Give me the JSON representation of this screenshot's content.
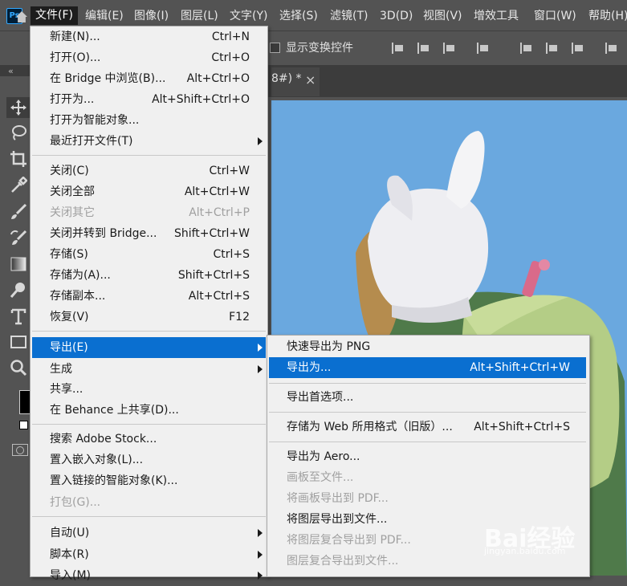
{
  "app": {
    "logo_text": "Ps"
  },
  "menubar": {
    "items": [
      "文件(F)",
      "编辑(E)",
      "图像(I)",
      "图层(L)",
      "文字(Y)",
      "选择(S)",
      "滤镜(T)",
      "3D(D)",
      "视图(V)",
      "增效工具",
      "窗口(W)",
      "帮助(H)"
    ]
  },
  "options_bar": {
    "show_transform_label": "显示变换控件"
  },
  "document": {
    "tab_title_visible": "8#) *",
    "close_glyph": "×"
  },
  "toolbar": {
    "collapse_glyph": "«"
  },
  "file_menu": {
    "groups": [
      [
        {
          "label": "新建(N)...",
          "shortcut": "Ctrl+N"
        },
        {
          "label": "打开(O)...",
          "shortcut": "Ctrl+O"
        },
        {
          "label": "在 Bridge 中浏览(B)...",
          "shortcut": "Alt+Ctrl+O"
        },
        {
          "label": "打开为...",
          "shortcut": "Alt+Shift+Ctrl+O"
        },
        {
          "label": "打开为智能对象...",
          "shortcut": ""
        },
        {
          "label": "最近打开文件(T)",
          "shortcut": "",
          "submenu": true
        }
      ],
      [
        {
          "label": "关闭(C)",
          "shortcut": "Ctrl+W"
        },
        {
          "label": "关闭全部",
          "shortcut": "Alt+Ctrl+W"
        },
        {
          "label": "关闭其它",
          "shortcut": "Alt+Ctrl+P",
          "disabled": true
        },
        {
          "label": "关闭并转到 Bridge...",
          "shortcut": "Shift+Ctrl+W"
        },
        {
          "label": "存储(S)",
          "shortcut": "Ctrl+S"
        },
        {
          "label": "存储为(A)...",
          "shortcut": "Shift+Ctrl+S"
        },
        {
          "label": "存储副本...",
          "shortcut": "Alt+Ctrl+S"
        },
        {
          "label": "恢复(V)",
          "shortcut": "F12"
        }
      ],
      [
        {
          "label": "导出(E)",
          "shortcut": "",
          "submenu": true,
          "highlighted": true
        },
        {
          "label": "生成",
          "shortcut": "",
          "submenu": true
        },
        {
          "label": "共享...",
          "shortcut": ""
        },
        {
          "label": "在 Behance 上共享(D)...",
          "shortcut": ""
        }
      ],
      [
        {
          "label": "搜索 Adobe Stock...",
          "shortcut": ""
        },
        {
          "label": "置入嵌入对象(L)...",
          "shortcut": ""
        },
        {
          "label": "置入链接的智能对象(K)...",
          "shortcut": ""
        },
        {
          "label": "打包(G)...",
          "shortcut": "",
          "disabled": true
        }
      ],
      [
        {
          "label": "自动(U)",
          "shortcut": "",
          "submenu": true
        },
        {
          "label": "脚本(R)",
          "shortcut": "",
          "submenu": true
        },
        {
          "label": "导入(M)",
          "shortcut": "",
          "submenu": true
        }
      ]
    ]
  },
  "export_menu": {
    "groups": [
      [
        {
          "label": "快速导出为 PNG",
          "shortcut": ""
        },
        {
          "label": "导出为...",
          "shortcut": "Alt+Shift+Ctrl+W",
          "highlighted": true
        }
      ],
      [
        {
          "label": "导出首选项...",
          "shortcut": ""
        }
      ],
      [
        {
          "label": "存储为 Web 所用格式（旧版）...",
          "shortcut": "Alt+Shift+Ctrl+S"
        }
      ],
      [
        {
          "label": "导出为 Aero...",
          "shortcut": ""
        },
        {
          "label": "画板至文件...",
          "shortcut": "",
          "disabled": true
        },
        {
          "label": "将画板导出到 PDF...",
          "shortcut": "",
          "disabled": true
        },
        {
          "label": "将图层导出到文件...",
          "shortcut": ""
        },
        {
          "label": "将图层复合导出到 PDF...",
          "shortcut": "",
          "disabled": true
        },
        {
          "label": "图层复合导出到文件...",
          "shortcut": "",
          "disabled": true
        }
      ]
    ]
  },
  "watermark": {
    "text": "Bai经验",
    "sub": "jingyan.baidu.com"
  },
  "colors": {
    "menu_bg": "#f0f0f0",
    "highlight": "#0a6fd0",
    "chrome": "#535353",
    "sky": "#6aa8df"
  }
}
